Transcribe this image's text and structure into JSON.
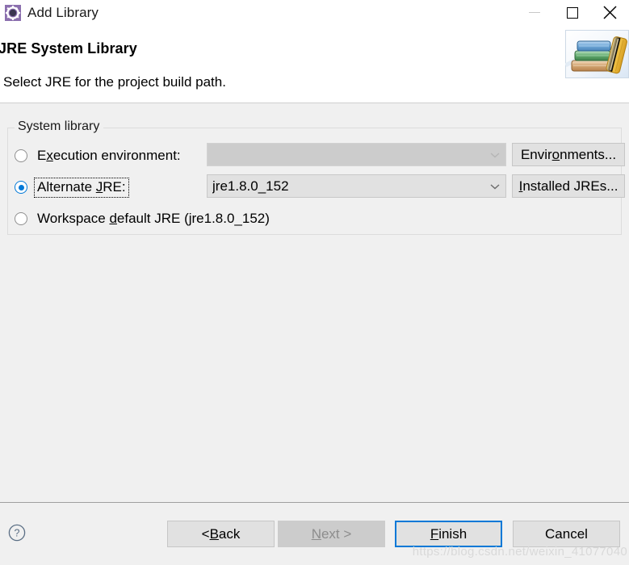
{
  "window": {
    "title": "Add Library",
    "icon": "library-gear-icon",
    "controls": {
      "minimize": "minimize-icon",
      "maximize": "maximize-icon",
      "close": "close-icon"
    }
  },
  "header": {
    "title": "JRE System Library",
    "description": "Select JRE for the project build path.",
    "image": "books-stack-icon"
  },
  "group": {
    "legend": "System library",
    "options": [
      {
        "id": "execution-environment",
        "label_pre": "E",
        "label_mnemonic": "x",
        "label_post": "ecution environment:",
        "selected": false,
        "focused": false,
        "combo": {
          "value": "",
          "enabled": false,
          "arrow": "chevron-down-icon"
        },
        "button": {
          "label_pre": "Envir",
          "label_mnemonic": "o",
          "label_post": "nments...",
          "enabled": true
        }
      },
      {
        "id": "alternate-jre",
        "label_pre": "Alternate ",
        "label_mnemonic": "J",
        "label_post": "RE:",
        "selected": true,
        "focused": true,
        "combo": {
          "value": "jre1.8.0_152",
          "enabled": true,
          "arrow": "chevron-down-icon"
        },
        "button": {
          "label_pre": "",
          "label_mnemonic": "I",
          "label_post": "nstalled JREs...",
          "enabled": true
        }
      },
      {
        "id": "workspace-default-jre",
        "label_pre": "Workspace ",
        "label_mnemonic": "d",
        "label_post": "efault JRE (jre1.8.0_152)",
        "selected": false,
        "focused": false,
        "combo": null,
        "button": null
      }
    ]
  },
  "footer": {
    "help_icon": "help-question-icon",
    "buttons": [
      {
        "id": "back",
        "label_pre": "< ",
        "label_mnemonic": "B",
        "label_post": "ack",
        "enabled": true,
        "default": false
      },
      {
        "id": "next",
        "label_pre": "",
        "label_mnemonic": "N",
        "label_post": "ext >",
        "enabled": false,
        "default": false
      },
      {
        "id": "finish",
        "label_pre": "",
        "label_mnemonic": "F",
        "label_post": "inish",
        "enabled": true,
        "default": true
      },
      {
        "id": "cancel",
        "label_pre": "Cancel",
        "label_mnemonic": "",
        "label_post": "",
        "enabled": true,
        "default": false
      }
    ]
  },
  "watermark": {
    "text": "https://blog.csdn.net/weixin_41077040"
  },
  "colors": {
    "accent": "#0078d7",
    "dialog_bg": "#f0f0f0",
    "header_bg": "#ffffff",
    "control_bg": "#e1e1e1",
    "disabled_bg": "#cccccc",
    "border": "#c6c6c6"
  }
}
